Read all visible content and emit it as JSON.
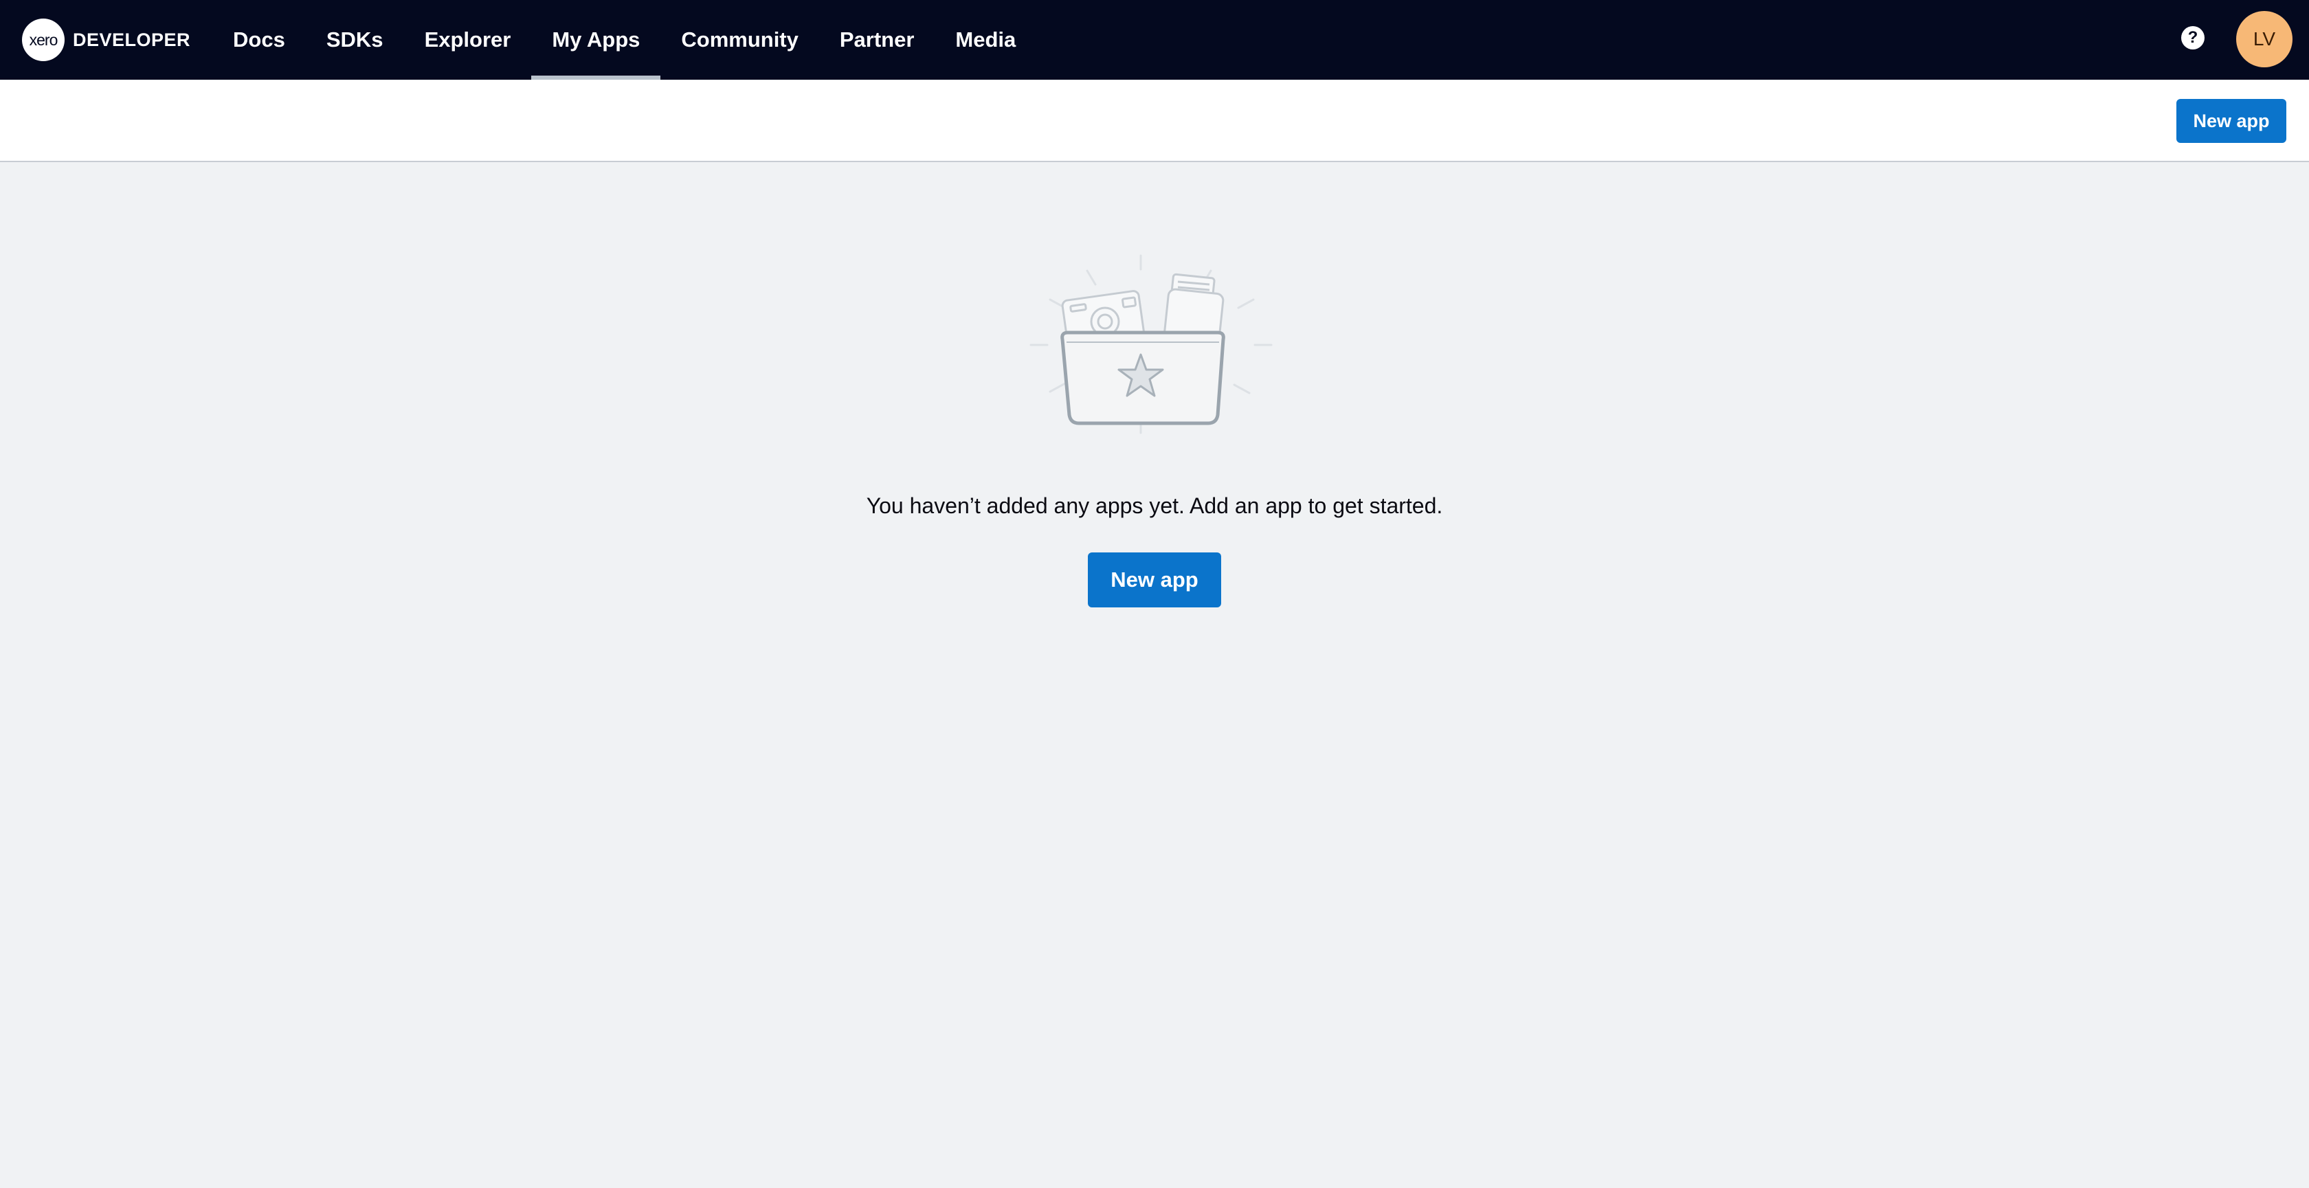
{
  "brand": {
    "logo_text": "xero",
    "label": "DEVELOPER"
  },
  "nav": {
    "items": [
      {
        "label": "Docs"
      },
      {
        "label": "SDKs"
      },
      {
        "label": "Explorer"
      },
      {
        "label": "My Apps"
      },
      {
        "label": "Community"
      },
      {
        "label": "Partner"
      },
      {
        "label": "Media"
      }
    ],
    "active": "My Apps"
  },
  "header": {
    "help_label": "?",
    "avatar_initials": "LV"
  },
  "toolbar": {
    "new_app_label": "New app"
  },
  "empty_state": {
    "message": "You haven’t added any apps yet. Add an app to get started.",
    "new_app_label": "New app",
    "illustration_icon": "folder-with-apps-icon"
  },
  "colors": {
    "nav_background": "#04091f",
    "accent": "#0b74cb",
    "avatar": "#f7b876",
    "page_background": "#f0f2f4"
  }
}
